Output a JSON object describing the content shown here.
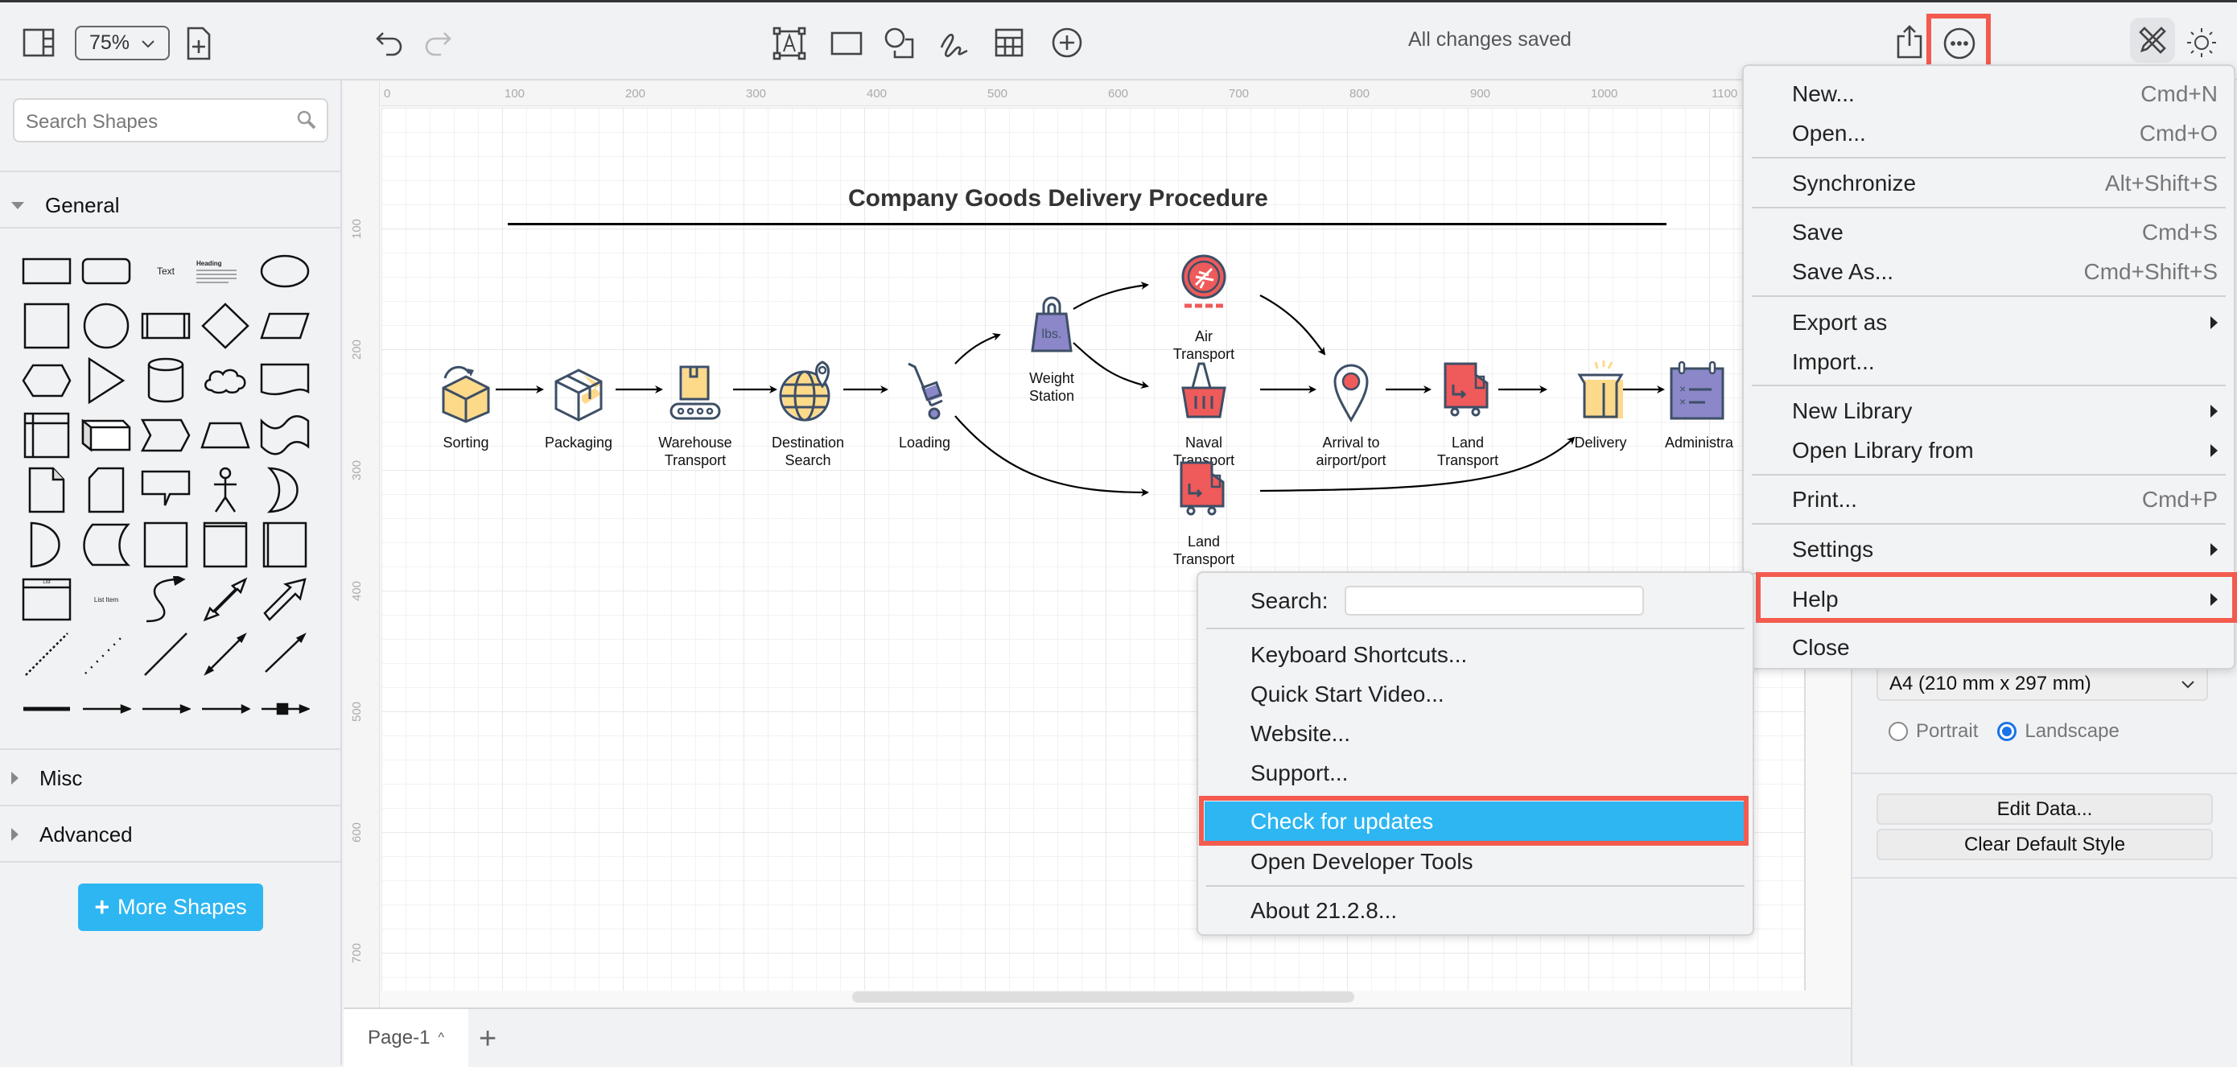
{
  "toolbar": {
    "zoom_value": "75%",
    "status": "All changes saved",
    "icons": [
      "format-panel-icon",
      "zoom-dropdown",
      "insert-page-icon",
      "undo-icon",
      "redo-icon",
      "text-tool-icon",
      "rectangle-tool-icon",
      "shapes-tool-icon",
      "freehand-icon",
      "table-icon",
      "insert-icon",
      "share-icon",
      "more-options-icon",
      "edit-mode-icon",
      "theme-sun-icon"
    ]
  },
  "sidebar": {
    "search_placeholder": "Search Shapes",
    "sections": [
      {
        "label": "General",
        "expanded": true
      },
      {
        "label": "Misc",
        "expanded": false
      },
      {
        "label": "Advanced",
        "expanded": false
      }
    ],
    "shape_labels": {
      "text": "Text",
      "heading": "Heading",
      "list": "List",
      "list_item": "List Item"
    },
    "more_shapes": "More Shapes"
  },
  "canvas": {
    "ruler_top": [
      "0",
      "100",
      "200",
      "300",
      "400",
      "500",
      "600",
      "700",
      "800",
      "900",
      "1000",
      "1100"
    ],
    "ruler_left": [
      "100",
      "200",
      "300",
      "400",
      "500",
      "600",
      "700"
    ],
    "diagram_title": "Company Goods Delivery Procedure",
    "nodes": [
      {
        "id": "sorting",
        "label": "Sorting"
      },
      {
        "id": "packaging",
        "label": "Packaging"
      },
      {
        "id": "warehouse",
        "label": "Warehouse\nTransport"
      },
      {
        "id": "destination",
        "label": "Destination\nSearch"
      },
      {
        "id": "loading",
        "label": "Loading"
      },
      {
        "id": "weight",
        "label": "Weight\nStation",
        "icon_text": "lbs."
      },
      {
        "id": "air",
        "label": "Air\nTransport"
      },
      {
        "id": "naval",
        "label": "Naval\nTransport"
      },
      {
        "id": "land2",
        "label": "Land\nTransport"
      },
      {
        "id": "arrival",
        "label": "Arrival to\nairport/port"
      },
      {
        "id": "land1",
        "label": "Land\nTransport"
      },
      {
        "id": "delivery",
        "label": "Delivery"
      },
      {
        "id": "admin",
        "label": "Administra"
      }
    ],
    "colors": {
      "yellow": "#fdd98a",
      "red": "#ef5a5a",
      "purple": "#8b87c8",
      "outline": "#3d4f66"
    }
  },
  "pages": {
    "current": "Page-1",
    "add": "+"
  },
  "right_panel": {
    "paper_size": "A4 (210 mm x 297 mm)",
    "orientation": {
      "portrait": "Portrait",
      "landscape": "Landscape",
      "selected": "landscape"
    },
    "edit_data": "Edit Data...",
    "clear_default_style": "Clear Default Style"
  },
  "main_menu": {
    "items": [
      {
        "label": "New...",
        "shortcut": "Cmd+N"
      },
      {
        "label": "Open...",
        "shortcut": "Cmd+O"
      },
      {
        "label": "Synchronize",
        "shortcut": "Alt+Shift+S"
      },
      {
        "label": "Save",
        "shortcut": "Cmd+S"
      },
      {
        "label": "Save As...",
        "shortcut": "Cmd+Shift+S"
      },
      {
        "label": "Export as",
        "submenu": true
      },
      {
        "label": "Import..."
      },
      {
        "label": "New Library",
        "submenu": true
      },
      {
        "label": "Open Library from",
        "submenu": true
      },
      {
        "label": "Print...",
        "shortcut": "Cmd+P"
      },
      {
        "label": "Settings",
        "submenu": true
      },
      {
        "label": "Help",
        "submenu": true,
        "highlighted_box": true
      },
      {
        "label": "Close"
      }
    ]
  },
  "help_menu": {
    "search_label": "Search:",
    "search_value": "",
    "items": [
      {
        "label": "Keyboard Shortcuts..."
      },
      {
        "label": "Quick Start Video..."
      },
      {
        "label": "Website..."
      },
      {
        "label": "Support..."
      },
      {
        "label": "Check for updates",
        "selected": true
      },
      {
        "label": "Open Developer Tools"
      },
      {
        "label": "About 21.2.8..."
      }
    ]
  },
  "highlight_color": "#f35b4f",
  "accent_color": "#2db6f2"
}
